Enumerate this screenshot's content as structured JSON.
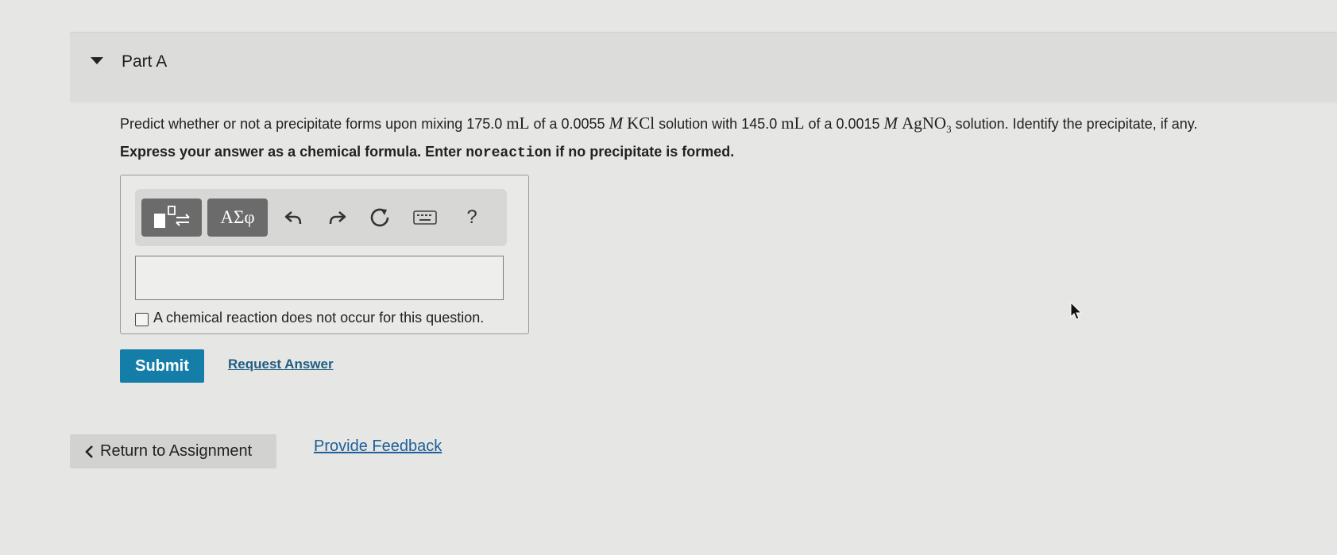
{
  "part": {
    "title": "Part A"
  },
  "question": {
    "t1": "Predict whether or not a precipitate forms upon mixing 175.0",
    "unit1": "mL",
    "t2": "of a 0.0055",
    "molar1": "M",
    "cmpd1": "KCl",
    "t3": "solution with 145.0",
    "unit2": "mL",
    "t4": "of a 0.0015",
    "molar2": "M",
    "cmpd2_main": "AgNO",
    "cmpd2_sub": "3",
    "t5": "solution. Identify the precipitate, if any."
  },
  "instructions": {
    "before": "Express your answer as a chemical formula. Enter",
    "keyword": "noreaction",
    "after": "if no precipitate is formed."
  },
  "toolbar": {
    "greek_label": "ΑΣφ",
    "help_label": "?"
  },
  "answer": {
    "value": "",
    "no_reaction_label": "A chemical reaction does not occur for this question."
  },
  "actions": {
    "submit_label": "Submit",
    "request_label": "Request Answer"
  },
  "footer": {
    "return_label": "Return to Assignment",
    "feedback_label": "Provide Feedback"
  },
  "colors": {
    "accent": "#157ea8",
    "link": "#1f5f9a",
    "toolbar_dark": "#6b6b6b"
  },
  "icons": {
    "toggle": "caret-down-icon",
    "templates": "templates-icon",
    "undo": "undo-icon",
    "redo": "redo-icon",
    "reset": "reset-icon",
    "keyboard": "keyboard-icon",
    "back": "chevron-left-icon",
    "cursor": "mouse-cursor-icon"
  }
}
